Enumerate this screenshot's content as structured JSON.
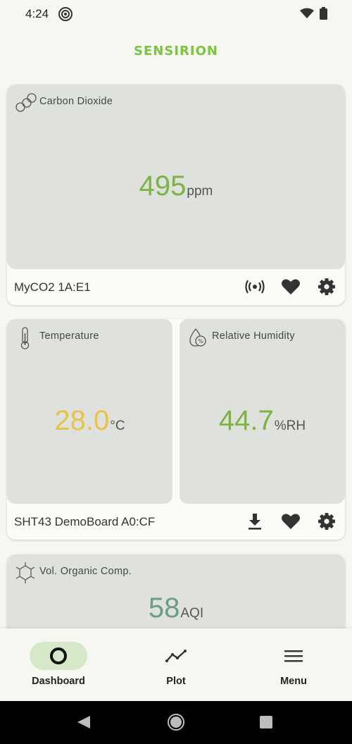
{
  "status_bar": {
    "time": "4:24"
  },
  "brand": {
    "logo": "SENSIRION",
    "accent": "#7cc33f"
  },
  "cards": [
    {
      "device": "MyCO2 1A:E1",
      "panels": [
        {
          "title": "Carbon Dioxide",
          "icon": "co2-molecule-icon",
          "value": "495",
          "unit": "ppm",
          "value_color": "#7cb342"
        }
      ],
      "actions": [
        "broadcast-icon",
        "favorite-heart-icon",
        "settings-gear-icon"
      ]
    },
    {
      "device": "SHT43 DemoBoard A0:CF",
      "panels": [
        {
          "title": "Temperature",
          "icon": "thermometer-icon",
          "value": "28.0",
          "unit": "°C",
          "value_color": "#e8c34a"
        },
        {
          "title": "Relative Humidity",
          "icon": "humidity-drop-icon",
          "value": "44.7",
          "unit": "%RH",
          "value_color": "#7cb342"
        }
      ],
      "actions": [
        "download-icon",
        "favorite-heart-icon",
        "settings-gear-icon"
      ]
    },
    {
      "panels": [
        {
          "title": "Vol. Organic Comp.",
          "icon": "voc-molecule-icon",
          "value": "58",
          "unit": "AQI",
          "value_color": "#6a9e84"
        }
      ]
    }
  ],
  "nav": {
    "items": [
      {
        "label": "Dashboard",
        "icon": "dashboard-ring-icon",
        "active": true
      },
      {
        "label": "Plot",
        "icon": "plot-line-icon",
        "active": false
      },
      {
        "label": "Menu",
        "icon": "menu-hamburger-icon",
        "active": false
      }
    ],
    "active_pill_color": "#d5e8c8"
  }
}
